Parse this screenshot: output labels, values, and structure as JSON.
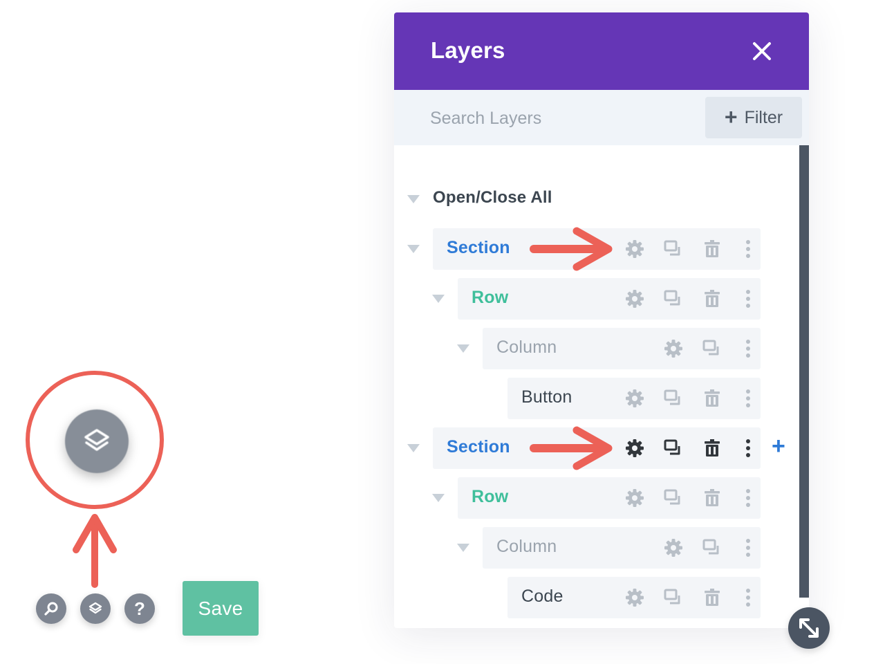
{
  "panel": {
    "title": "Layers",
    "close_icon": "close-icon",
    "search": {
      "placeholder": "Search Layers",
      "value": ""
    },
    "filter_label": "Filter",
    "toggle_all_label": "Open/Close All",
    "header_color": "#6536b6"
  },
  "layers": [
    {
      "type": "section",
      "label": "Section"
    },
    {
      "type": "row",
      "label": "Row"
    },
    {
      "type": "column",
      "label": "Column"
    },
    {
      "type": "module",
      "label": "Button"
    },
    {
      "type": "section",
      "label": "Section"
    },
    {
      "type": "row",
      "label": "Row"
    },
    {
      "type": "column",
      "label": "Column"
    },
    {
      "type": "module",
      "label": "Code"
    }
  ],
  "toolbar": {
    "help_label": "?",
    "save_label": "Save",
    "save_color": "#5fc1a2"
  },
  "colors": {
    "section": "#2f7bd7",
    "row": "#3fbf9b",
    "annotation": "#ec6157"
  }
}
